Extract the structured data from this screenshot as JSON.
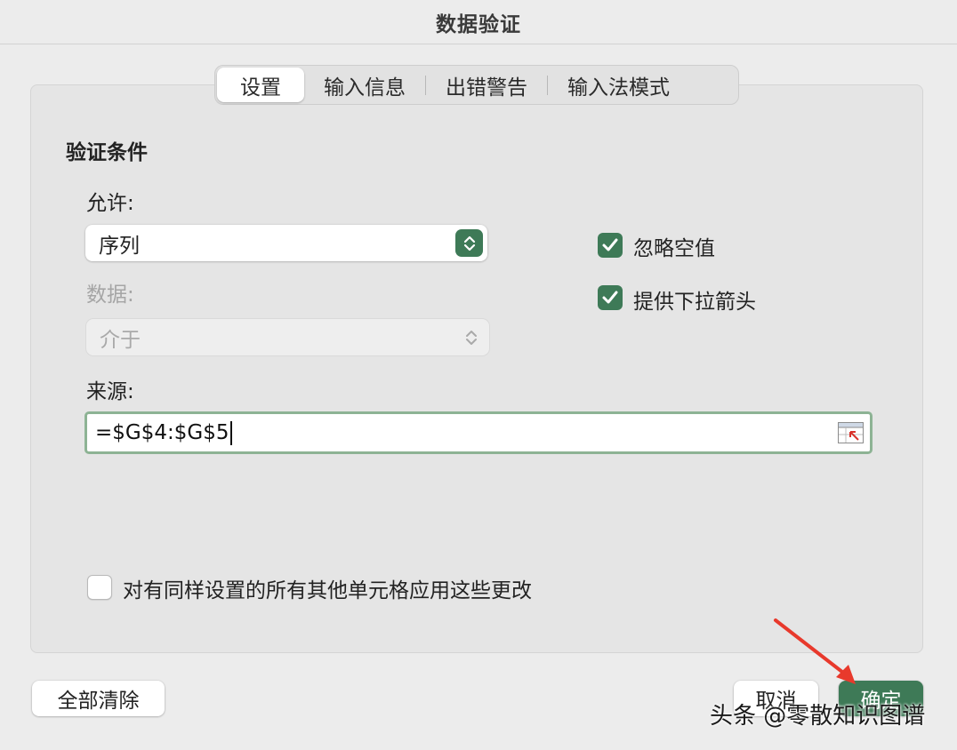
{
  "window": {
    "title": "数据验证"
  },
  "tabs": [
    {
      "label": "设置",
      "active": true
    },
    {
      "label": "输入信息",
      "active": false
    },
    {
      "label": "出错警告",
      "active": false
    },
    {
      "label": "输入法模式",
      "active": false
    }
  ],
  "settings": {
    "section_title": "验证条件",
    "allow_label": "允许:",
    "allow_value": "序列",
    "data_label": "数据:",
    "data_value": "介于",
    "source_label": "来源:",
    "source_value": "=$G$4:$G$5",
    "ignore_blank": {
      "label": "忽略空值",
      "checked": true
    },
    "in_cell_dropdown": {
      "label": "提供下拉箭头",
      "checked": true
    },
    "apply_all": {
      "label": "对有同样设置的所有其他单元格应用这些更改",
      "checked": false
    }
  },
  "buttons": {
    "clear_all": "全部清除",
    "cancel": "取消",
    "ok": "确定"
  },
  "watermark": "头条 @零散知识图谱",
  "colors": {
    "accent": "#3e7a57",
    "focus_border": "#8db394",
    "annotation_arrow": "#e8392c"
  }
}
